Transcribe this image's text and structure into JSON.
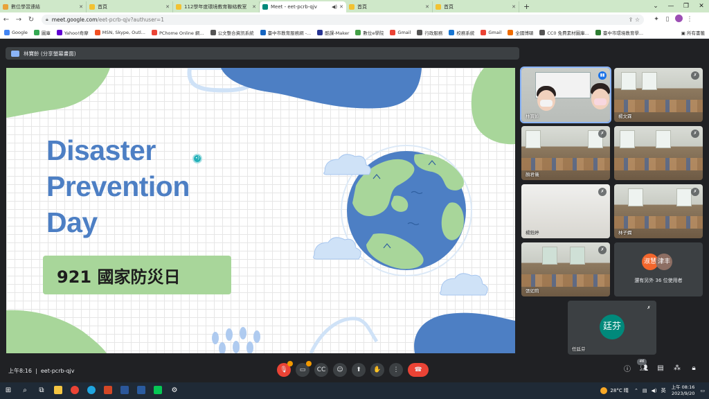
{
  "browser": {
    "tabs": [
      {
        "title": "數位學習連結",
        "color": "#e8a23a",
        "active": false
      },
      {
        "title": "首頁",
        "color": "#f2c232",
        "active": false
      },
      {
        "title": "112學年度環境教育聯絡教室",
        "color": "#f2c232",
        "active": false
      },
      {
        "title": "Meet - eet-pcrb-qjv",
        "color": "#00897b",
        "active": true
      },
      {
        "title": "首頁",
        "color": "#f2c232",
        "active": false
      },
      {
        "title": "首頁",
        "color": "#f2c232",
        "active": false
      }
    ],
    "new_tab": "+",
    "url_host": "meet.google.com",
    "url_path": "/eet-pcrb-qjv?authuser=1",
    "bookmarks": [
      {
        "label": "Google",
        "color": "#4285f4"
      },
      {
        "label": "圖庫",
        "color": "#34a853"
      },
      {
        "label": "Yahoo!奇摩",
        "color": "#6001d2"
      },
      {
        "label": "MSN, Skype, Outl...",
        "color": "#f25022"
      },
      {
        "label": "PChome Online 網...",
        "color": "#ea4335"
      },
      {
        "label": "公文整合資訊系統",
        "color": "#555555"
      },
      {
        "label": "臺中市教育服務網 -...",
        "color": "#1565c0"
      },
      {
        "label": "酷課-Maker",
        "color": "#283593"
      },
      {
        "label": "數位e學院",
        "color": "#43a047"
      },
      {
        "label": "Gmail",
        "color": "#ea4335"
      },
      {
        "label": "行政服務",
        "color": "#555555"
      },
      {
        "label": "校務系統",
        "color": "#1976d2"
      },
      {
        "label": "Gmail",
        "color": "#ea4335"
      },
      {
        "label": "全國博碩",
        "color": "#ef6c00"
      },
      {
        "label": "CC0 免費素材圖庫...",
        "color": "#555555"
      },
      {
        "label": "臺中市環境教育學...",
        "color": "#2e7d32"
      }
    ],
    "bookmarks_all": "所有書籤"
  },
  "meet": {
    "presenting_label": "林寶齡 (分享螢幕畫面)",
    "slide": {
      "title_lines": [
        "Disaster",
        "Prevention",
        "Day"
      ],
      "banner": "921 國家防災日"
    },
    "participants": [
      {
        "name": "林寶齡",
        "kind": "teacher",
        "speaking": true
      },
      {
        "name": "楊文霖",
        "kind": "room"
      },
      {
        "name": "顏君儀",
        "kind": "room"
      },
      {
        "name": "",
        "kind": "room"
      },
      {
        "name": "楊鈺婷",
        "kind": "girl"
      },
      {
        "name": "林子嫻",
        "kind": "room"
      },
      {
        "name": "張如莉",
        "kind": "room"
      }
    ],
    "others": {
      "avatar1": "淑慧",
      "avatar2": "津丰",
      "caption": "還有另外 36 位使用者"
    },
    "self": {
      "initials": "廷芬",
      "name": "任廷芬"
    },
    "time": "上午8:16",
    "meeting_code": "eet-pcrb-qjv",
    "participant_count": "46"
  },
  "taskbar": {
    "weather": "28°C 晴",
    "ime": "英",
    "clock_time": "上午 08:16",
    "clock_date": "2023/9/20"
  }
}
